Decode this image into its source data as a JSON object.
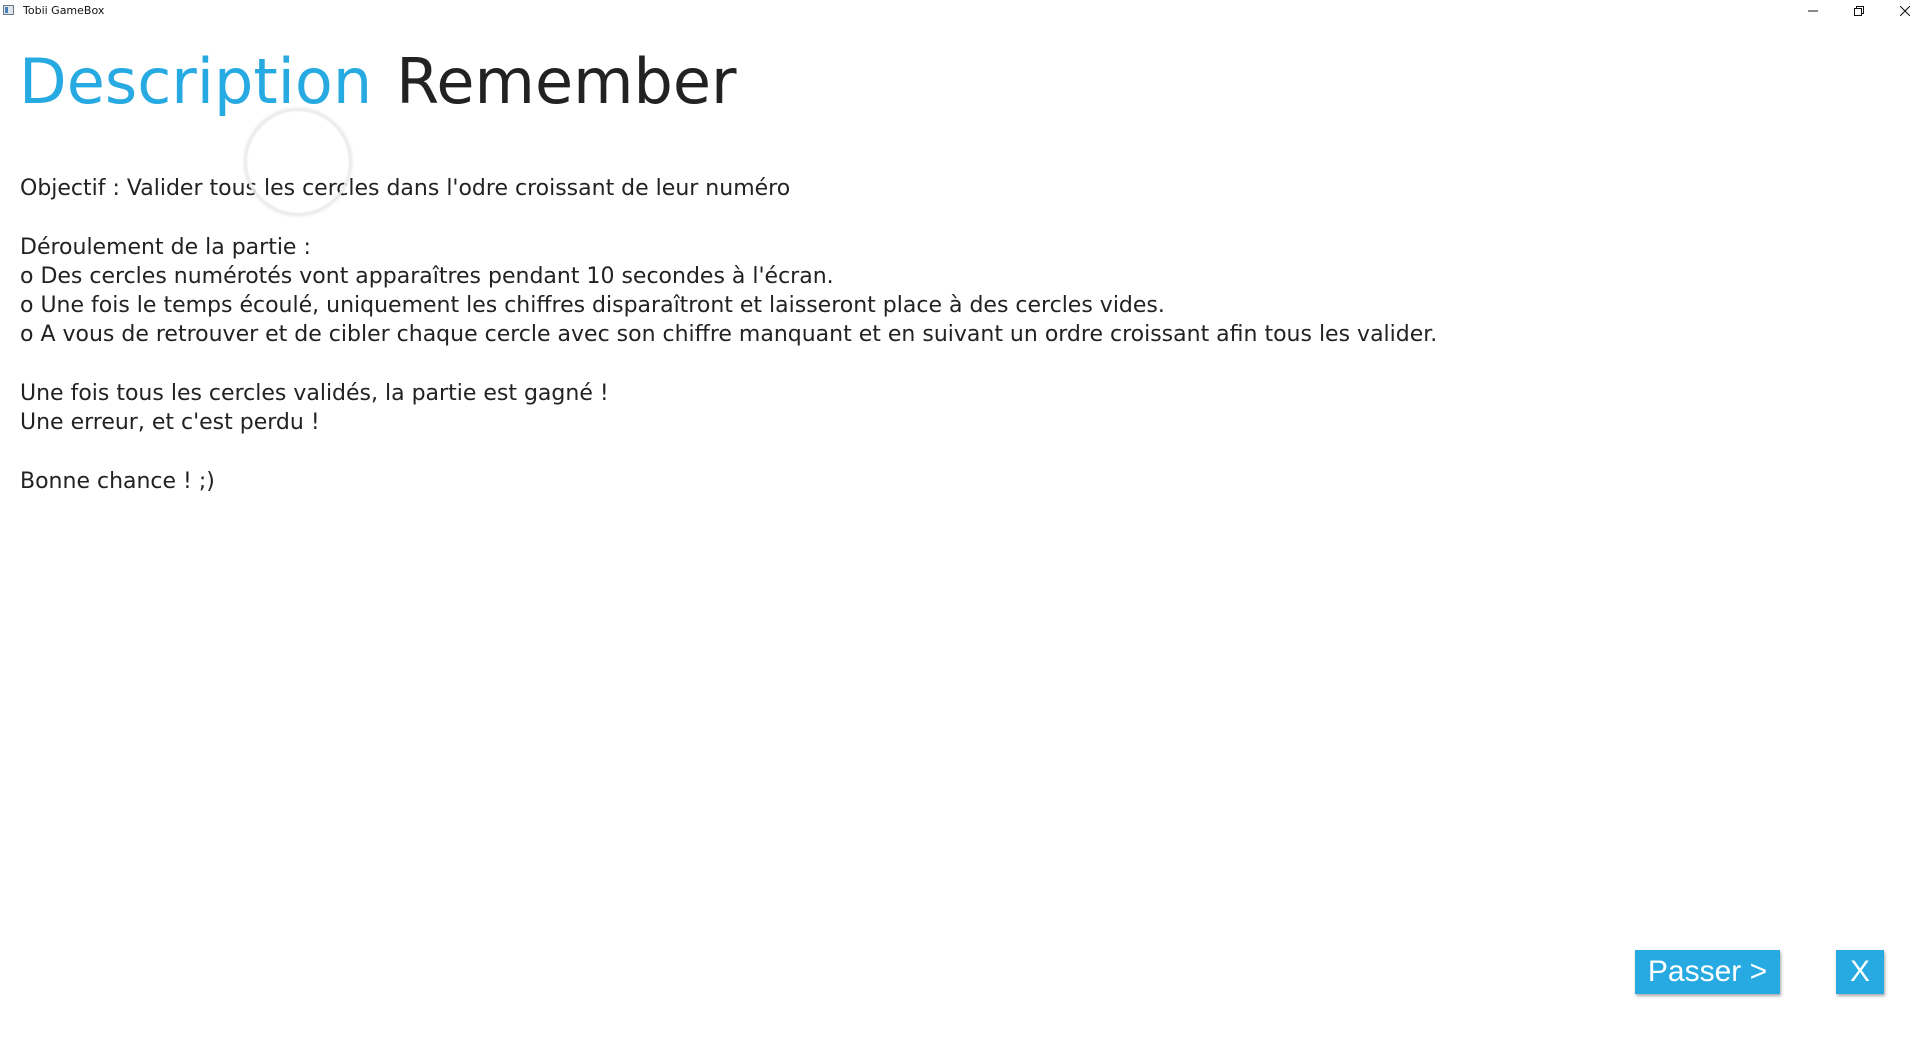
{
  "window": {
    "title": "Tobii GameBox",
    "icon": "app-window-icon",
    "controls": {
      "minimize_icon": "minimize-icon",
      "maximize_icon": "restore-icon",
      "close_icon": "close-icon"
    }
  },
  "header": {
    "description_tab": "Description",
    "game_title": "Remember",
    "accent_color": "#27aae1"
  },
  "content": {
    "objective": "Objectif : Valider tous les cercles dans l'odre croissant de leur numéro",
    "progress_heading": "Déroulement de la partie :",
    "steps": [
      "o Des cercles numérotés vont apparaîtres pendant 10 secondes à l'écran.",
      "o Une fois le temps écoulé, uniquement les chiffres disparaîtront et laisseront place à des cercles vides.",
      "o A vous de retrouver et de cibler chaque cercle avec son chiffre manquant et en suivant un ordre croissant afin tous les valider."
    ],
    "win_text": "Une fois tous les cercles validés, la partie est gagné !",
    "lose_text": "Une erreur, et c'est perdu !",
    "good_luck": "Bonne chance ! ;)"
  },
  "buttons": {
    "skip_label": "Passer >",
    "exit_label": "X",
    "button_color": "#27aae1"
  }
}
